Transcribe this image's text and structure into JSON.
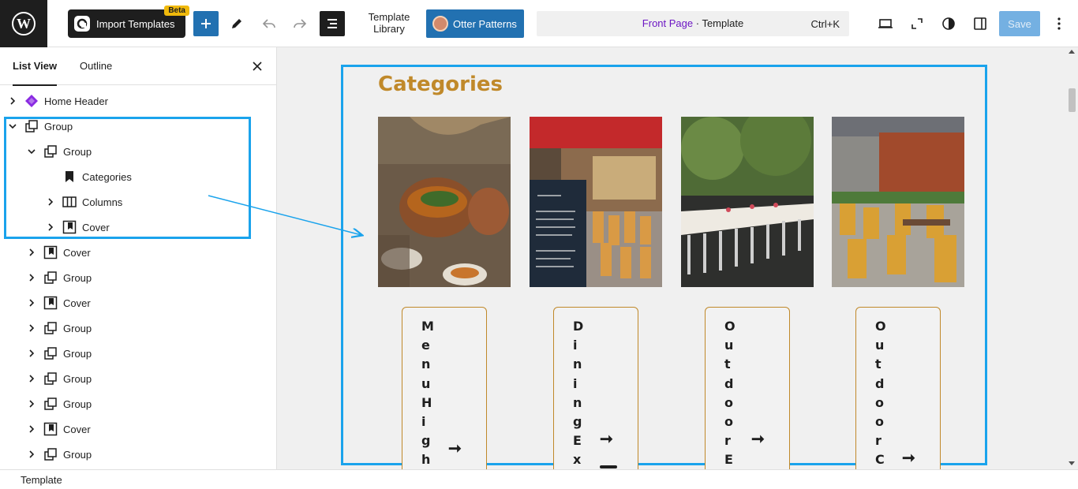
{
  "toolbar": {
    "import_label": "Import Templates",
    "beta_badge": "Beta",
    "template_library": "Template Library",
    "otter_label": "Otter Patterns",
    "command_page": "Front Page",
    "command_sep": " · ",
    "command_type": "Template",
    "command_shortcut": "Ctrl+K",
    "save_label": "Save",
    "accent_color": "#2271b1"
  },
  "sidebar": {
    "tabs": [
      {
        "label": "List View",
        "active": true
      },
      {
        "label": "Outline",
        "active": false
      }
    ],
    "rows": [
      {
        "label": "Home Header",
        "icon": "template-part-icon",
        "expand": "collapsed"
      },
      {
        "label": "Group",
        "icon": "group-icon",
        "expand": "expanded"
      },
      {
        "label": "Group",
        "icon": "group-icon",
        "expand": "expanded"
      },
      {
        "label": "Categories",
        "icon": "heading-bookmark-icon",
        "expand": "none"
      },
      {
        "label": "Columns",
        "icon": "columns-icon",
        "expand": "collapsed"
      },
      {
        "label": "Cover",
        "icon": "cover-icon",
        "expand": "collapsed"
      },
      {
        "label": "Cover",
        "icon": "cover-icon",
        "expand": "collapsed"
      },
      {
        "label": "Group",
        "icon": "group-icon",
        "expand": "collapsed"
      },
      {
        "label": "Cover",
        "icon": "cover-icon",
        "expand": "collapsed"
      },
      {
        "label": "Group",
        "icon": "group-icon",
        "expand": "collapsed"
      },
      {
        "label": "Group",
        "icon": "group-icon",
        "expand": "collapsed"
      },
      {
        "label": "Group",
        "icon": "group-icon",
        "expand": "collapsed"
      },
      {
        "label": "Group",
        "icon": "group-icon",
        "expand": "collapsed"
      },
      {
        "label": "Cover",
        "icon": "cover-icon",
        "expand": "collapsed"
      },
      {
        "label": "Group",
        "icon": "group-icon",
        "expand": "collapsed"
      }
    ]
  },
  "canvas": {
    "heading": "Categories",
    "heading_color": "#c0892a",
    "cards": [
      {
        "text": "MenuHigh",
        "photo": "food-bowl-photo"
      },
      {
        "text": "DiningEx",
        "photo": "cafe-menu-board-photo"
      },
      {
        "text": "OutdoorE",
        "photo": "outdoor-long-table-photo"
      },
      {
        "text": "OutdoorC",
        "photo": "terrace-chairs-photo"
      }
    ],
    "card_arrow": "➞"
  },
  "footer": {
    "breadcrumb": "Template"
  }
}
